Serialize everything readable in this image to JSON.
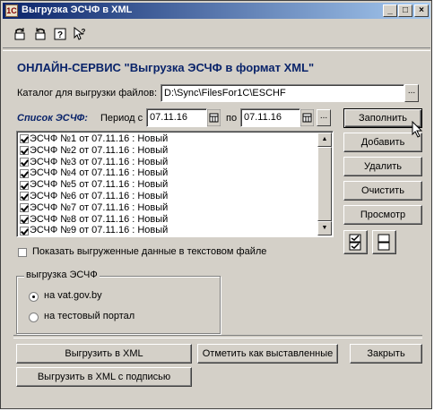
{
  "window": {
    "title": "Выгрузка ЭСЧФ в XML"
  },
  "heading": "ОНЛАЙН-СЕРВИС \"Выгрузка ЭСЧФ в формат XML\"",
  "catalog": {
    "label": "Каталог для выгрузки файлов:",
    "value": "D:\\Sync\\FilesFor1C\\ESCHF",
    "browse_label": "..."
  },
  "list": {
    "title": "Список ЭСЧФ:",
    "period_label": "Период с",
    "date_from": "07.11.16",
    "to_label": "по",
    "date_to": "07.11.16",
    "period_button": "...",
    "items": [
      "ЭСЧФ №1 от 07.11.16 : Новый",
      "ЭСЧФ №2 от 07.11.16 : Новый",
      "ЭСЧФ №3 от 07.11.16 : Новый",
      "ЭСЧФ №4 от 07.11.16 : Новый",
      "ЭСЧФ №5 от 07.11.16 : Новый",
      "ЭСЧФ №6 от 07.11.16 : Новый",
      "ЭСЧФ №7 от 07.11.16 : Новый",
      "ЭСЧФ №8 от 07.11.16 : Новый",
      "ЭСЧФ №9 от 07.11.16 : Новый"
    ]
  },
  "side_buttons": {
    "fill": "Заполнить",
    "add": "Добавить",
    "delete": "Удалить",
    "clear": "Очистить",
    "view": "Просмотр"
  },
  "show_text": {
    "label": "Показать выгруженные данные в текстовом файле",
    "checked": false
  },
  "export_group": {
    "title": "выгрузка ЭСЧФ",
    "options": [
      "на vat.gov.by",
      "на тестовый портал"
    ],
    "selected": 0
  },
  "bottom_buttons": {
    "export_xml": "Выгрузить в XML",
    "mark_issued": "Отметить как выставленные",
    "close": "Закрыть",
    "export_signed": "Выгрузить в XML с подписью"
  },
  "colors": {
    "titlebar_start": "#0a246a",
    "titlebar_end": "#a6caf0",
    "heading": "#0a246a",
    "list_title": "#0a246a",
    "face": "#d4d0c8"
  }
}
